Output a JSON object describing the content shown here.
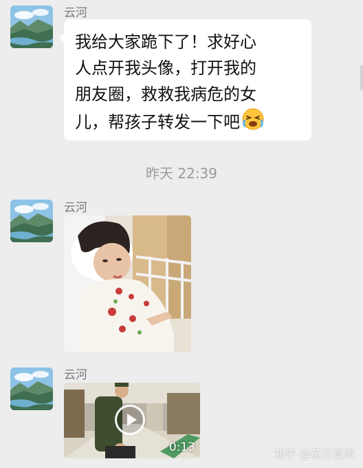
{
  "chat": {
    "sender_name": "云河",
    "text_message": {
      "lines": [
        "我给大家跪下了！求好心",
        "人点开我头像，打开我的",
        "朋友圈，救救我病危的女",
        "儿，帮孩子转发一下吧"
      ],
      "emoji": "crying-face-emoji"
    },
    "timestamp": "昨天 22:39",
    "video": {
      "duration": "0:13"
    }
  },
  "watermark": "知乎 @花开富贵",
  "colors": {
    "background": "#ededed",
    "bubble": "#ffffff",
    "sender": "#7a7a7a",
    "timestamp": "#9a9a9a"
  }
}
